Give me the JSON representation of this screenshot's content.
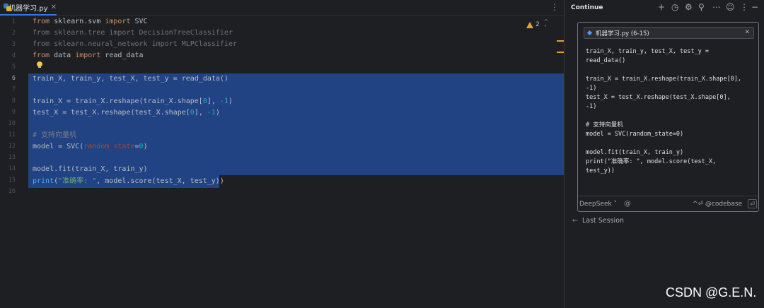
{
  "editor": {
    "tab": {
      "label": "机器学习.py",
      "close": "✕",
      "icon": "python-file-icon"
    },
    "more_icon": "⋮",
    "inspections": {
      "count": "2",
      "arrows": "^ ˅"
    },
    "line_numbers": [
      "1",
      "2",
      "3",
      "4",
      "5",
      "6",
      "7",
      "8",
      "9",
      "10",
      "11",
      "12",
      "13",
      "14",
      "15",
      "16"
    ],
    "current_line": "6",
    "code": {
      "l1": {
        "k1": "from",
        "m1": " sklearn.svm ",
        "k2": "import",
        "m2": " SVC"
      },
      "l2": "from sklearn.tree import DecisionTreeClassifier",
      "l3": "from sklearn.neural_network import MLPClassifier",
      "l4": {
        "k1": "from",
        "m1": " data ",
        "k2": "import",
        "m2": " read_data"
      },
      "l6": "train_X, train_y, test_X, test_y = read_data()",
      "l8": {
        "a": "train_X = train_X.reshape(train_X.shape[",
        "n1": "0",
        "b": "], ",
        "n2": "-1",
        "c": ")"
      },
      "l9": {
        "a": "test_X = test_X.reshape(test_X.shape[",
        "n1": "0",
        "b": "], ",
        "n2": "-1",
        "c": ")"
      },
      "l11": "# 支持向量机",
      "l12": {
        "a": "model = SVC(",
        "p": "random_state",
        "b": "=",
        "n": "0",
        "c": ")"
      },
      "l14": "model.fit(train_X, train_y)",
      "l15": {
        "f": "print",
        "a": "(",
        "s": "\"准确率: \"",
        "b": ", model.score(test_X, test_y))"
      }
    },
    "colors": {
      "selection": "#214283",
      "keyword": "#cf8e6d",
      "number": "#2aacb8",
      "string": "#6aab73",
      "warning": "#e2a33b"
    }
  },
  "panel": {
    "title": "Continue",
    "toolbar_icons": [
      "plus-icon",
      "history-icon",
      "settings-icon",
      "add-user-icon",
      "more-horizontal-icon",
      "emoji-icon",
      "more-vertical-icon",
      "minimize-icon"
    ],
    "context": {
      "label": "机器学习.py (6-15)",
      "close": "✕"
    },
    "snippet_lines": [
      "train_X, train_y, test_X, test_y =",
      "read_data()",
      "",
      "train_X = train_X.reshape(train_X.shape[0],",
      "-1)",
      "test_X = test_X.reshape(test_X.shape[0],",
      "-1)",
      "",
      "# 支持向量机",
      "model = SVC(random_state=0)",
      "",
      "model.fit(train_X, train_y)",
      "print(\"准确率: \", model.score(test_X,",
      "test_y))"
    ],
    "model": "DeepSeek",
    "at": "@",
    "codebase_hint": "^⏎ @codebase",
    "send": "⏎",
    "last_session": "Last Session"
  },
  "watermark": "CSDN @G.E.N."
}
